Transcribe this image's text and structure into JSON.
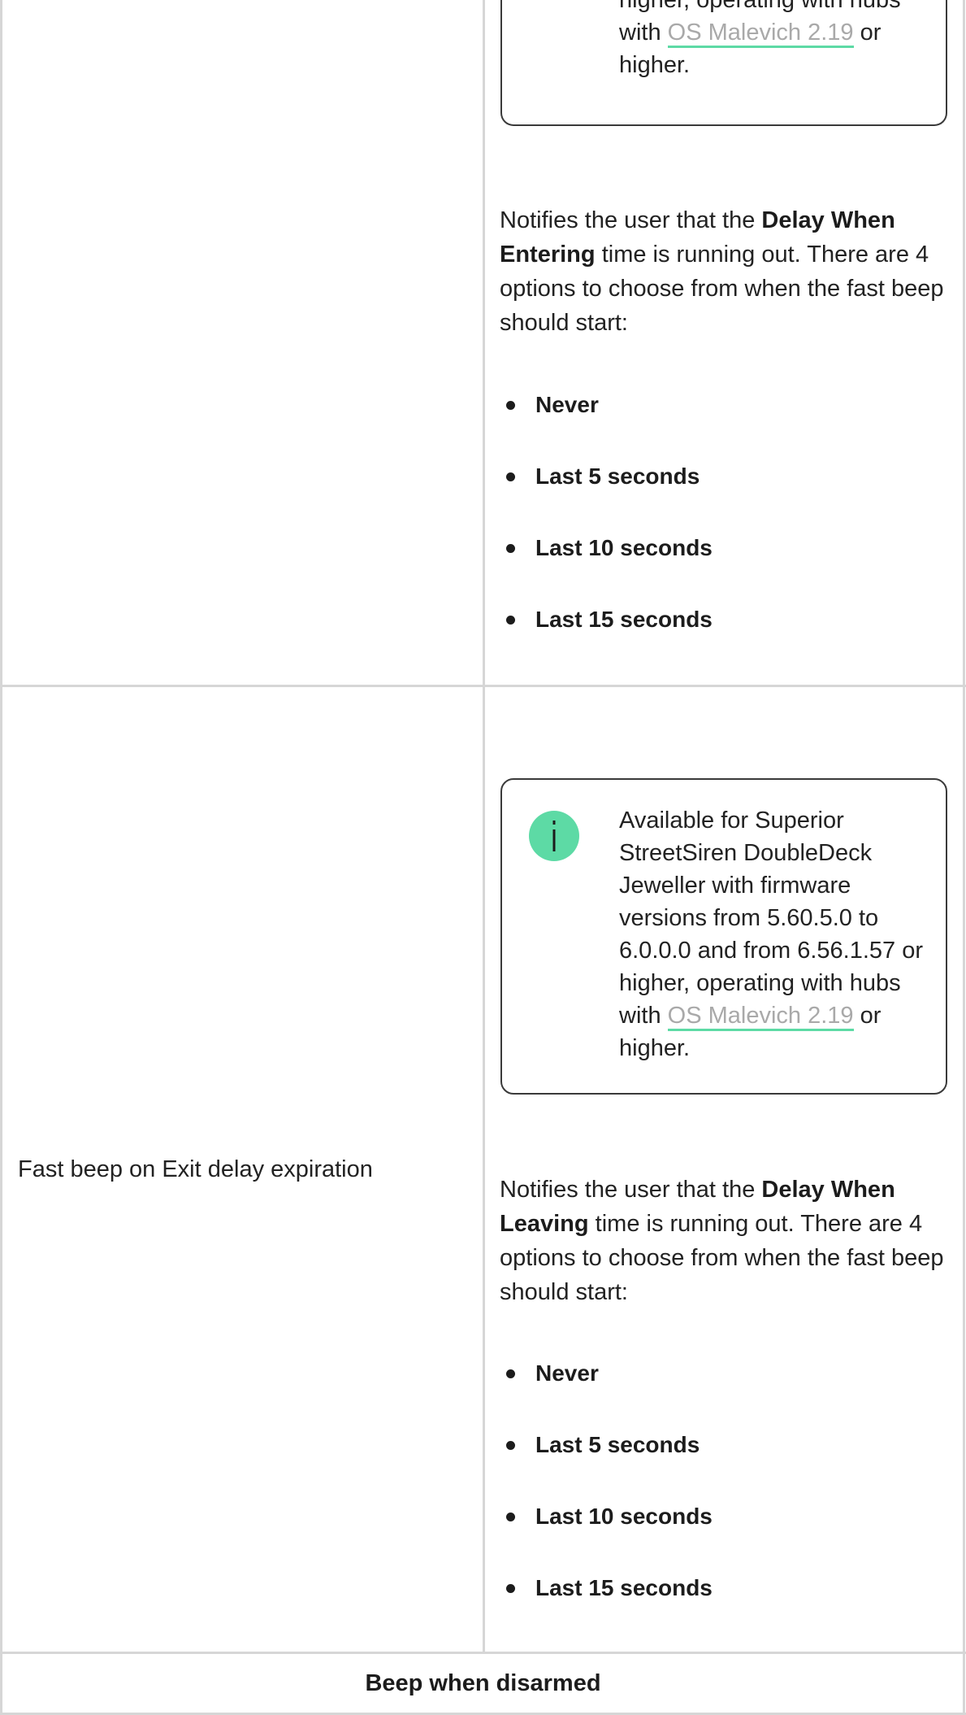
{
  "row_entry": {
    "note": {
      "lines_before_link": [
        "higher, operating with hubs",
        "with"
      ],
      "link": "OS Malevich 2.19",
      "after_link": "or",
      "last_line": "higher."
    },
    "intro": {
      "p1": "Notifies the user that the",
      "b1": "Delay When",
      "b2": "Entering",
      "p2": "time is running out. There are 4",
      "p3": "options to choose from when the fast beep",
      "p4": "should start:"
    },
    "options": [
      "Never",
      "Last 5 seconds",
      "Last 10 seconds",
      "Last 15 seconds"
    ]
  },
  "row_exit": {
    "label": "Fast beep on Exit delay expiration",
    "note": {
      "icon": "info-icon",
      "lines": [
        "Available for Superior",
        "StreetSiren DoubleDeck",
        "Jeweller with firmware",
        "versions from 5.60.5.0 to",
        "6.0.0.0 and from 6.56.1.57 or",
        "higher, operating with hubs"
      ],
      "with": "with",
      "link": "OS Malevich 2.19",
      "after_link": "or",
      "last_line": "higher."
    },
    "intro": {
      "p1": "Notifies the user that the",
      "b1": "Delay When",
      "b2": "Leaving",
      "p2": "time is running out. There are 4",
      "p3": "options to choose from when the fast beep",
      "p4": "should start:"
    },
    "options": [
      "Never",
      "Last 5 seconds",
      "Last 10 seconds",
      "Last 15 seconds"
    ]
  },
  "footer": {
    "title": "Beep when disarmed"
  },
  "colors": {
    "accent": "#5ddaa5",
    "link_text": "#a9a9a9",
    "border": "#d6d6d6"
  }
}
